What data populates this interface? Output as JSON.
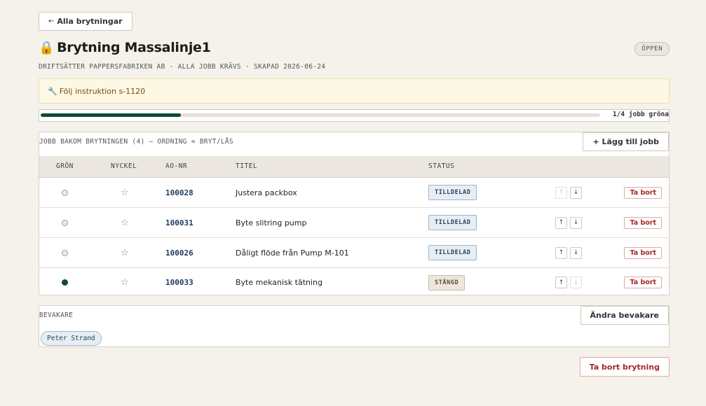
{
  "nav": {
    "back_arrow": "←",
    "back_label": "Alla brytningar"
  },
  "header": {
    "lock_icon": "🔒",
    "title": "Brytning Massalinje1",
    "status": "ÖPPEN",
    "meta": "DRIFTSÄTTER PAPPERSFABRIKEN AB · ALLA JOBB KRÄVS · SKAPAD 2026-06-24"
  },
  "notice": {
    "icon": "🔧",
    "text": "Följ instruktion s-1120"
  },
  "progress": {
    "done": 1,
    "total": 4,
    "label": "1/4 jobb gröna",
    "fill_color": "#0f4a35"
  },
  "jobs": {
    "caption": "JOBB BAKOM BRYTNINGEN (4) — ORDNING = BRYT/LÅS",
    "add_label": "+ Lägg till jobb",
    "columns": {
      "green": "GRÖN",
      "key": "NYCKEL",
      "ao": "AO-NR",
      "title": "TITEL",
      "status": "STATUS"
    },
    "rows": [
      {
        "green": false,
        "star": "☆",
        "ao": "100028",
        "title": "Justera packbox",
        "status": "TILLDELAD",
        "closed": false,
        "up_disabled": true,
        "down_disabled": false,
        "up": "↑",
        "down": "↓",
        "remove": "Ta bort"
      },
      {
        "green": false,
        "star": "☆",
        "ao": "100031",
        "title": "Byte slitring pump",
        "status": "TILLDELAD",
        "closed": false,
        "up_disabled": false,
        "down_disabled": false,
        "up": "↑",
        "down": "↓",
        "remove": "Ta bort"
      },
      {
        "green": false,
        "star": "☆",
        "ao": "100026",
        "title": "Dåligt flöde från Pump M-101",
        "status": "TILLDELAD",
        "closed": false,
        "up_disabled": false,
        "down_disabled": false,
        "up": "↑",
        "down": "↓",
        "remove": "Ta bort"
      },
      {
        "green": true,
        "star": "☆",
        "ao": "100033",
        "title": "Byte mekanisk tätning",
        "status": "STÄNGD",
        "closed": true,
        "up_disabled": false,
        "down_disabled": true,
        "up": "↑",
        "down": "↓",
        "remove": "Ta bort"
      }
    ]
  },
  "watchers": {
    "caption": "BEVAKARE",
    "change_label": "Ändra bevakare",
    "people": [
      "Peter Strand"
    ]
  },
  "footer": {
    "delete_label": "Ta bort brytning"
  },
  "colors": {
    "accent_green": "#0f4a35",
    "danger": "#a32a2a",
    "link_blue": "#1f3a5c"
  }
}
